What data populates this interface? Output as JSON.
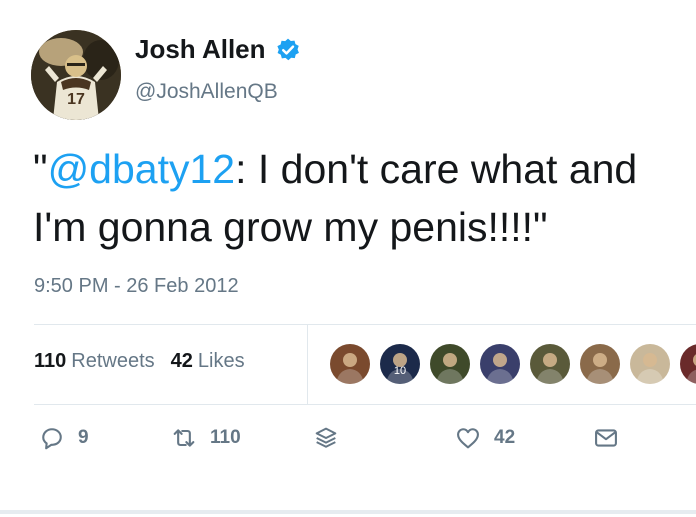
{
  "author": {
    "display_name": "Josh Allen",
    "handle": "@JoshAllenQB",
    "verified": true,
    "avatar_jersey_number": "17"
  },
  "tweet": {
    "text_open_quote": "\"",
    "mention": "@dbaty12",
    "text_line1_rest": ": I don't care what and",
    "text_line2": "I'm gonna grow my penis!!!!\"",
    "timestamp": "9:50 PM - 26 Feb 2012"
  },
  "stats": {
    "retweets_count": "110",
    "retweets_label": "Retweets",
    "likes_count": "42",
    "likes_label": "Likes"
  },
  "likers": [
    {
      "icon": "liker-avatar-1",
      "color": "#7a4a2e"
    },
    {
      "icon": "liker-avatar-2",
      "color": "#1c2a4a",
      "jersey": "10"
    },
    {
      "icon": "liker-avatar-3",
      "color": "#3f4a2a"
    },
    {
      "icon": "liker-avatar-4",
      "color": "#3a3f6b"
    },
    {
      "icon": "liker-avatar-5",
      "color": "#5a5a3a"
    },
    {
      "icon": "liker-avatar-6",
      "color": "#8a6a4a"
    },
    {
      "icon": "liker-avatar-7",
      "color": "#c9b89a"
    },
    {
      "icon": "liker-avatar-8",
      "color": "#6a2a2a"
    }
  ],
  "actions": {
    "reply_count": "9",
    "retweet_count": "110",
    "like_count": "42"
  },
  "colors": {
    "accent": "#1da1f2",
    "text": "#14171a",
    "muted": "#657786"
  }
}
